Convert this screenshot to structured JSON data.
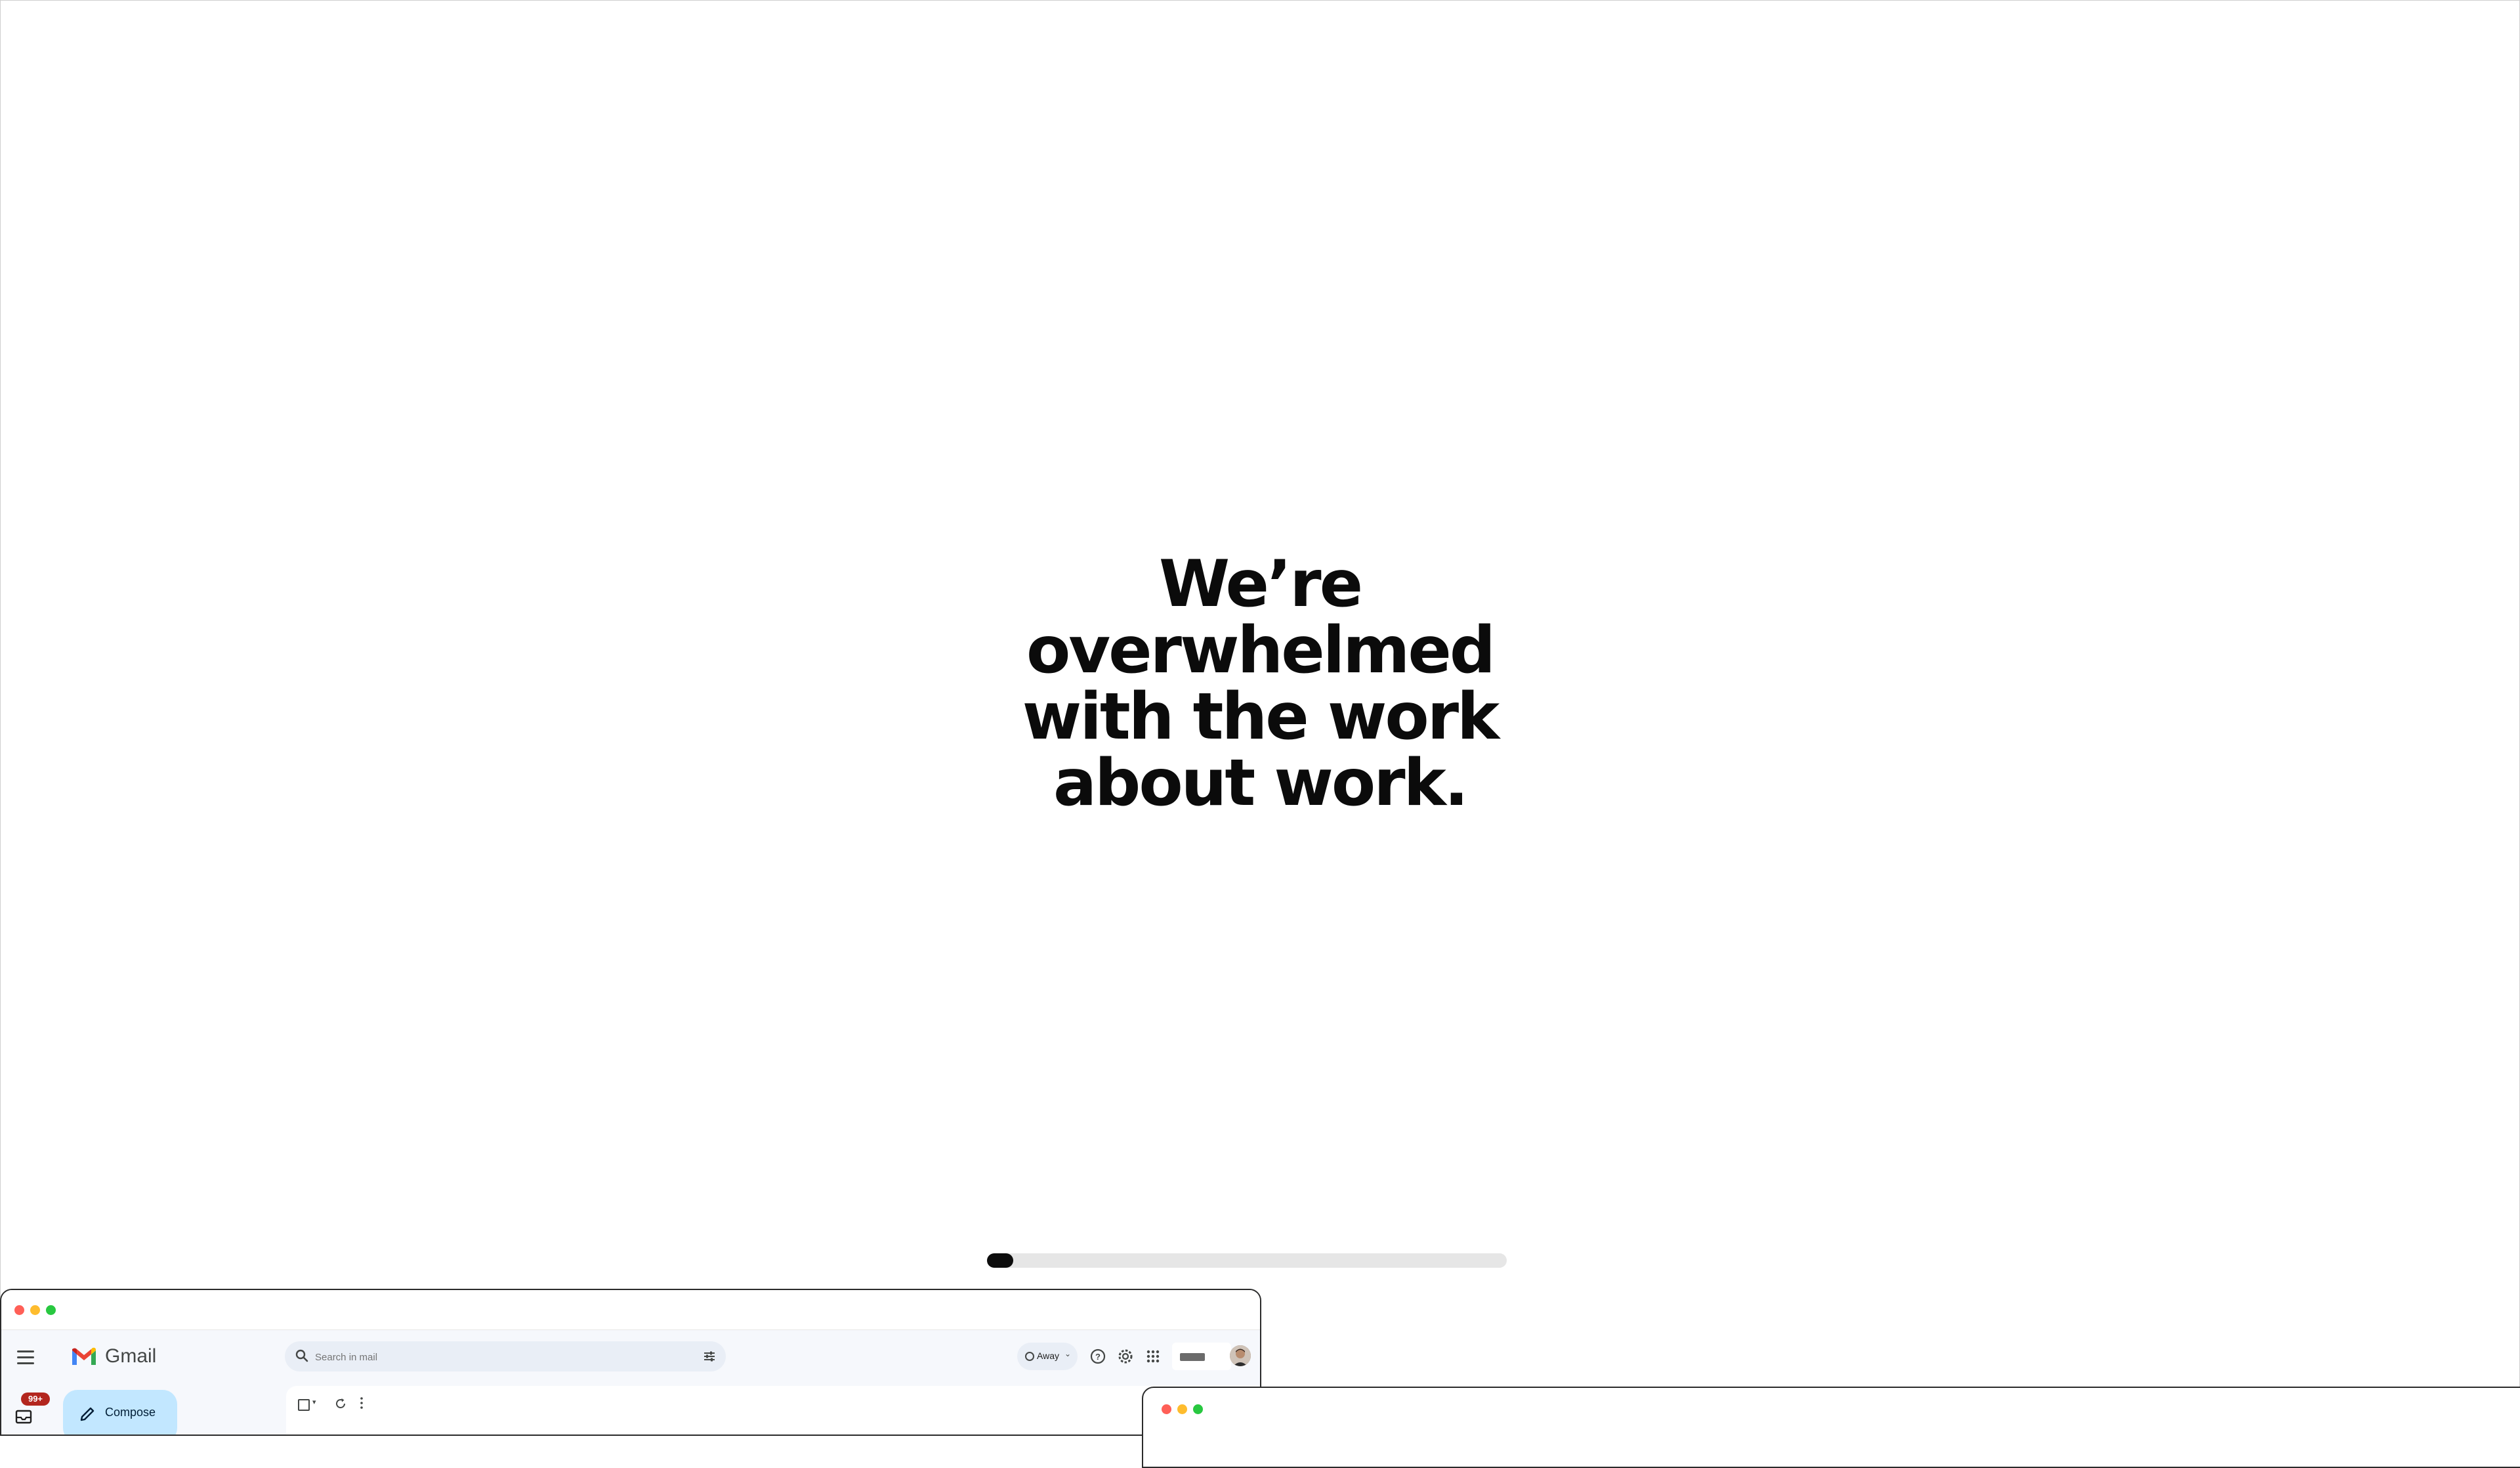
{
  "hero": {
    "headline_lines": [
      "We’re overwhelmed",
      "with the work",
      "about work."
    ]
  },
  "progress": {
    "value": 0.05
  },
  "gmail_window": {
    "app_name": "Gmail",
    "search": {
      "placeholder": "Search in mail"
    },
    "status": {
      "label": "Away"
    },
    "compose_label": "Compose",
    "inbox_badge": "99+",
    "icons": [
      "menu-icon",
      "gmail-logo",
      "search-icon",
      "filter-icon",
      "help-icon",
      "settings-icon",
      "apps-grid-icon",
      "checkbox-icon",
      "refresh-icon",
      "more-vert-icon",
      "pencil-icon",
      "inbox-icon"
    ]
  },
  "colors": {
    "headline": "#0b0b0b",
    "progress_fill": "#0d0d0d",
    "progress_track": "#e6e6e6",
    "compose_bg": "#c2e7ff",
    "search_bg": "#e9eef6",
    "badge": "#b3261e",
    "traffic_red": "#ff5f57",
    "traffic_yellow": "#febc2e",
    "traffic_green": "#28c840"
  }
}
